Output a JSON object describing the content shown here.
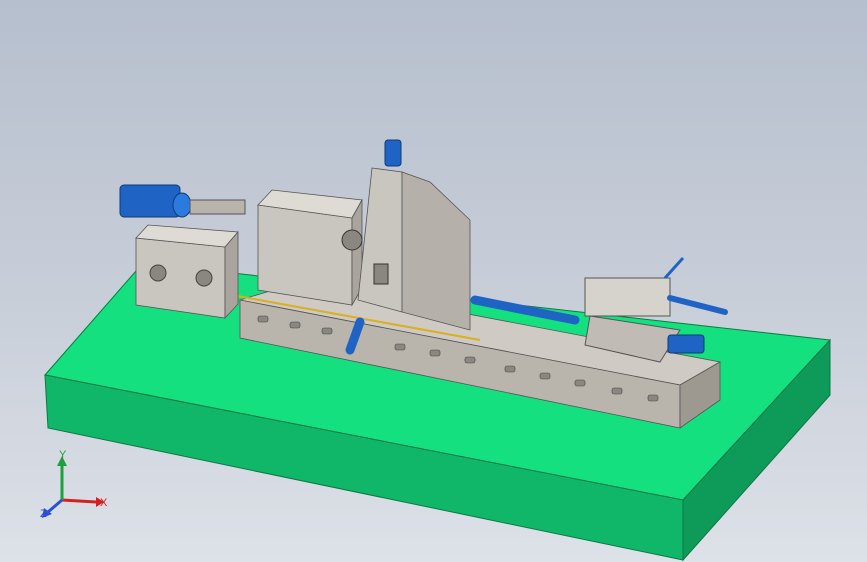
{
  "viewport": {
    "background_top": "#b6bfce",
    "background_bottom": "#dde1e8"
  },
  "scene": {
    "description_colors": {
      "base_top": "#14e07f",
      "base_front": "#10b769",
      "base_side": "#0e9b59",
      "machine_gray": "#c9c6c0",
      "machine_dark": "#8a8780",
      "motor_blue": "#1f64c4"
    }
  },
  "triad": {
    "x_label": "X",
    "y_label": "Y",
    "z_label": "Z",
    "x_color": "#d42020",
    "y_color": "#1aa33a",
    "z_color": "#2a4fd8"
  }
}
